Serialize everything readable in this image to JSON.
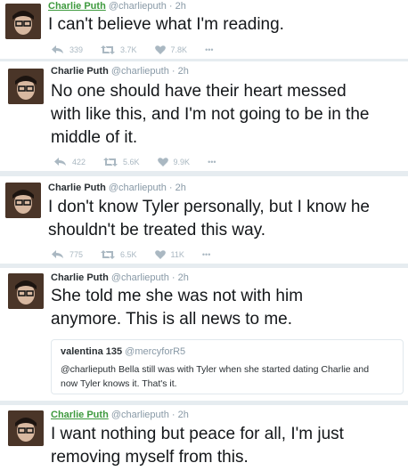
{
  "tweets": [
    {
      "author": "Charlie Puth",
      "handle": "@charlieputh",
      "separator": "·",
      "time": "2h",
      "lines": [
        "I can't believe what I'm reading."
      ],
      "replies": "339",
      "retweets": "3.7K",
      "likes": "7.8K",
      "more": "•••"
    },
    {
      "author": "Charlie Puth",
      "handle": "@charlieputh",
      "separator": "·",
      "time": "2h",
      "lines": [
        "No one should have their heart messed",
        "with like this, and I'm not going to be in the",
        "middle of it."
      ],
      "replies": "422",
      "retweets": "5.6K",
      "likes": "9.9K",
      "more": "•••"
    },
    {
      "author": "Charlie Puth",
      "handle": "@charlieputh",
      "separator": "·",
      "time": "2h",
      "lines": [
        "I don't know Tyler personally, but I know he",
        "shouldn't be treated this way."
      ],
      "replies": "775",
      "retweets": "6.5K",
      "likes": "11K",
      "more": "•••"
    },
    {
      "author": "Charlie Puth",
      "handle": "@charlieputh",
      "separator": "·",
      "time": "2h",
      "lines": [
        "She told me she was not with him",
        "anymore. This is all news to me."
      ],
      "quote": {
        "name": "valentina 135",
        "handle": "@mercyforR5",
        "lines": [
          "@charlieputh Bella still was with Tyler when she started dating Charlie and",
          "now Tyler knows it. That's it."
        ]
      }
    },
    {
      "author": "Charlie Puth",
      "handle": "@charlieputh",
      "separator": "·",
      "time": "2h",
      "lines": [
        "I want nothing but peace for all, I'm just",
        "removing myself from this."
      ]
    }
  ],
  "icons": {
    "reply": "reply-icon",
    "retweet": "retweet-icon",
    "like": "heart-icon",
    "more": "more-icon"
  },
  "colors": {
    "author_link": "#3e9a3e",
    "muted": "#8899a6",
    "action": "#aab8c2"
  }
}
